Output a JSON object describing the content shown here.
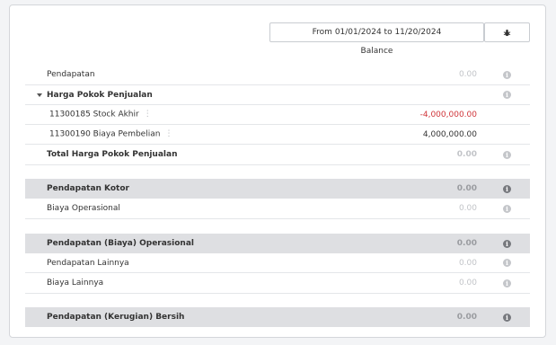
{
  "header": {
    "date_range": "From 01/01/2024 to 11/20/2024",
    "balance_label": "Balance",
    "action_icon": "bug-icon"
  },
  "rows": {
    "pendapatan": {
      "label": "Pendapatan",
      "value": "0.00"
    },
    "hpp": {
      "label": "Harga Pokok Penjualan"
    },
    "stock_akhir": {
      "label": "11300185 Stock Akhir",
      "value": "-4,000,000.00"
    },
    "biaya_pembelian": {
      "label": "11300190 Biaya Pembelian",
      "value": "4,000,000.00"
    },
    "total_hpp": {
      "label": "Total Harga Pokok Penjualan",
      "value": "0.00"
    },
    "pendapatan_kotor": {
      "label": "Pendapatan Kotor",
      "value": "0.00"
    },
    "biaya_operasional": {
      "label": "Biaya Operasional",
      "value": "0.00"
    },
    "pendapatan_operasional": {
      "label": "Pendapatan (Biaya) Operasional",
      "value": "0.00"
    },
    "pendapatan_lainnya": {
      "label": "Pendapatan Lainnya",
      "value": "0.00"
    },
    "biaya_lainnya": {
      "label": "Biaya Lainnya",
      "value": "0.00"
    },
    "bersih": {
      "label": "Pendapatan (Kerugian) Bersih",
      "value": "0.00"
    }
  },
  "info_glyph": "i",
  "kebab_glyph": "⋮",
  "colors": {
    "negative": "#d0353a",
    "shaded_row": "#dedfe2",
    "muted": "#c2c4c8"
  }
}
